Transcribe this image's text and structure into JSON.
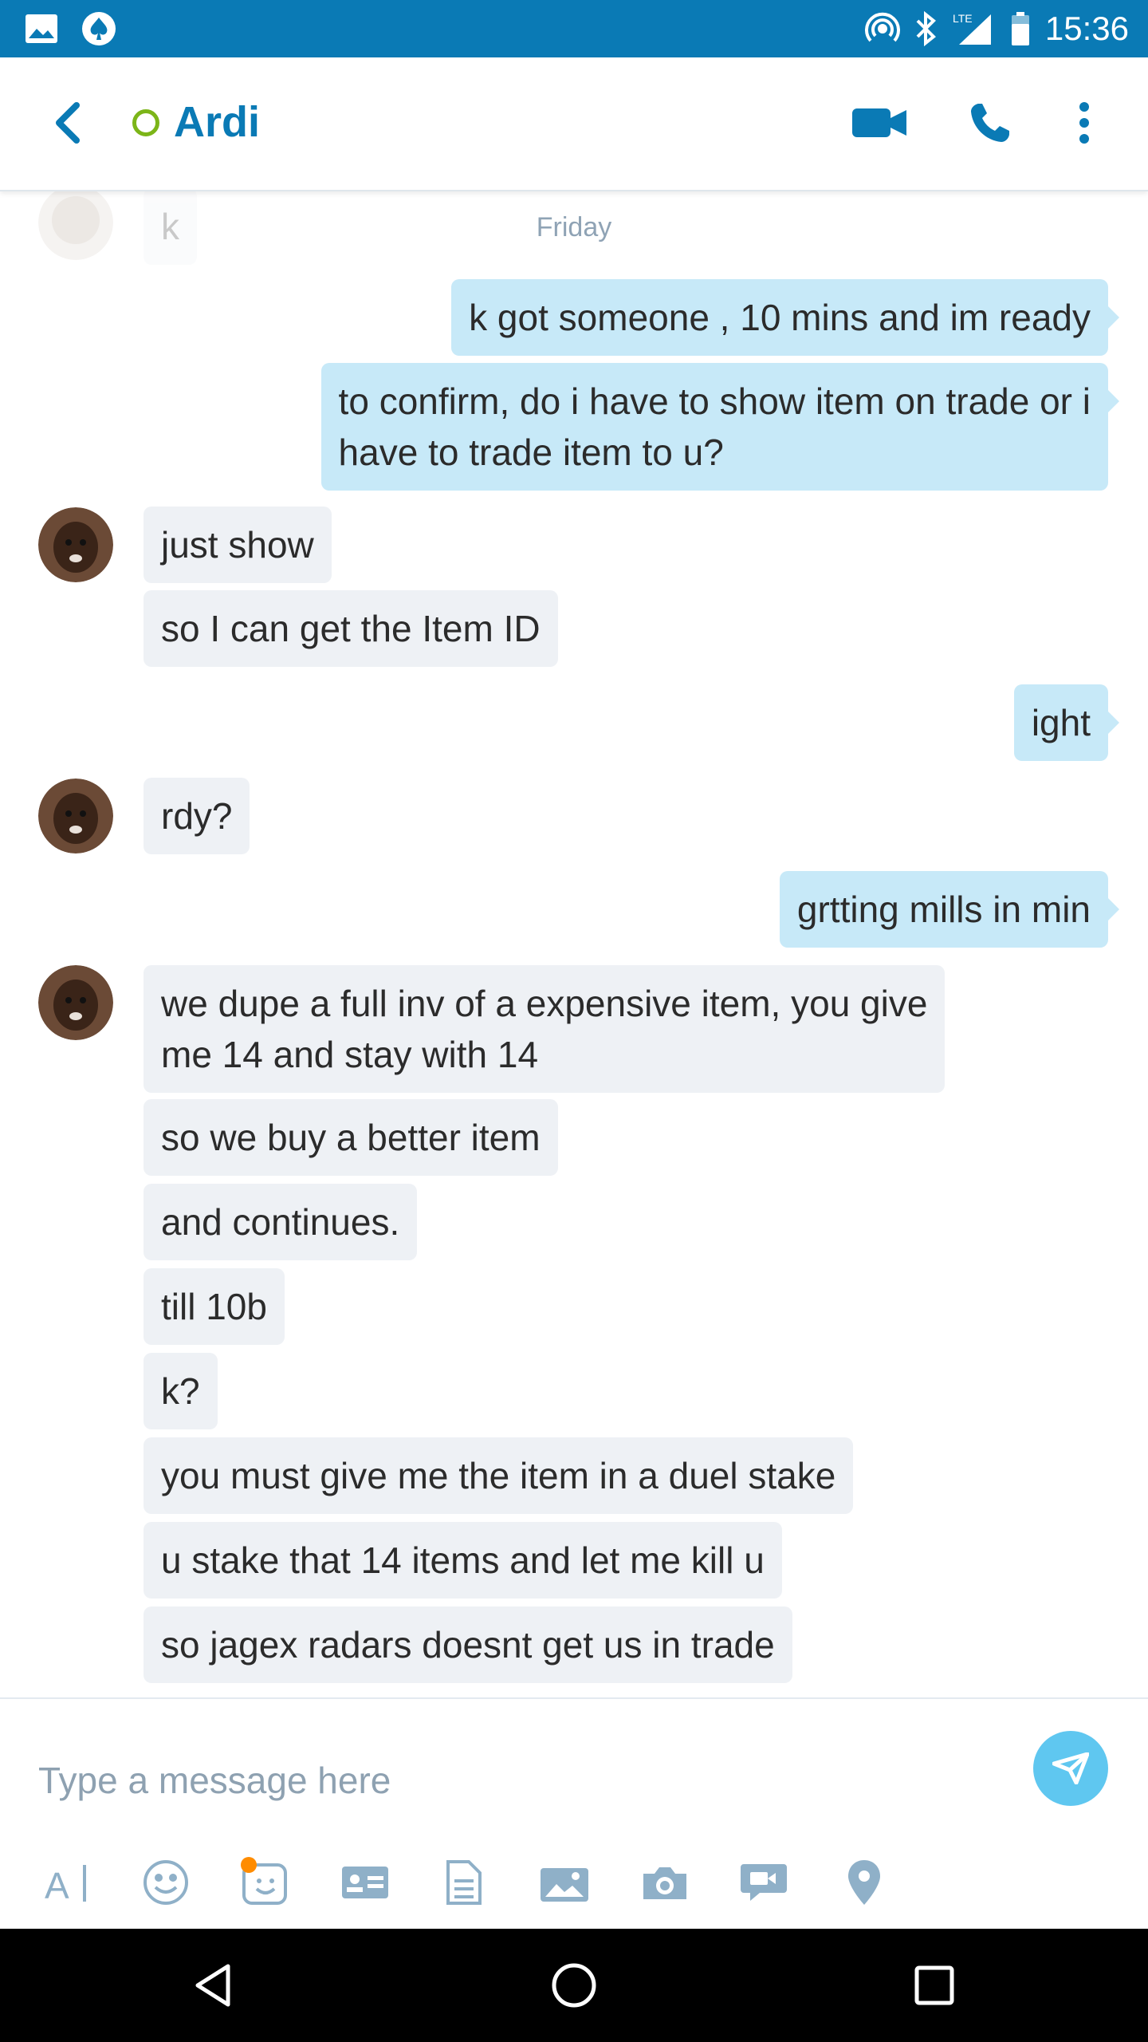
{
  "status_bar": {
    "time": "15:36",
    "network": "LTE",
    "left_icons": [
      "image-icon",
      "poker-spade-icon"
    ],
    "right_icons": [
      "hotspot-icon",
      "bluetooth-icon",
      "signal-icon",
      "battery-icon"
    ]
  },
  "header": {
    "contact_name": "Ardi",
    "presence_color": "#7cb518",
    "accent": "#0a7ab5"
  },
  "chat": {
    "day_label": "Friday",
    "faded_message": "k",
    "messages": [
      {
        "side": "out",
        "lines": [
          "k got someone , 10 mins and im ready"
        ]
      },
      {
        "side": "out",
        "lines": [
          "to confirm, do i have to show item on trade or i",
          "have to trade item to u?"
        ]
      },
      {
        "side": "in",
        "lines": [
          "just show"
        ]
      },
      {
        "side": "in",
        "lines": [
          "so I can get the Item ID"
        ]
      },
      {
        "side": "out",
        "lines": [
          "ight"
        ]
      },
      {
        "side": "in",
        "lines": [
          "rdy?"
        ]
      },
      {
        "side": "out",
        "lines": [
          "grtting mills in min"
        ]
      },
      {
        "side": "in",
        "lines": [
          "we dupe a full inv of a expensive item, you give",
          "me 14 and stay with 14"
        ]
      },
      {
        "side": "in",
        "lines": [
          "so we buy a better item"
        ]
      },
      {
        "side": "in",
        "lines": [
          "and continues."
        ]
      },
      {
        "side": "in",
        "lines": [
          "till 10b"
        ]
      },
      {
        "side": "in",
        "lines": [
          "k?"
        ]
      },
      {
        "side": "in",
        "lines": [
          "you must give me the item in a duel stake"
        ]
      },
      {
        "side": "in",
        "lines": [
          "u stake that 14 items and let me kill u"
        ]
      },
      {
        "side": "in",
        "lines": [
          "so jagex radars doesnt get us in trade"
        ]
      }
    ]
  },
  "composer": {
    "placeholder": "Type a message here",
    "tools": [
      "text-format-icon",
      "emoji-icon",
      "mojis-icon",
      "contact-card-icon",
      "file-icon",
      "photo-gallery-icon",
      "camera-icon",
      "video-message-icon",
      "location-icon"
    ],
    "send_color": "#5fc7f0"
  },
  "nav_bar": {
    "buttons": [
      "back-nav-icon",
      "home-nav-icon",
      "recents-nav-icon"
    ]
  }
}
